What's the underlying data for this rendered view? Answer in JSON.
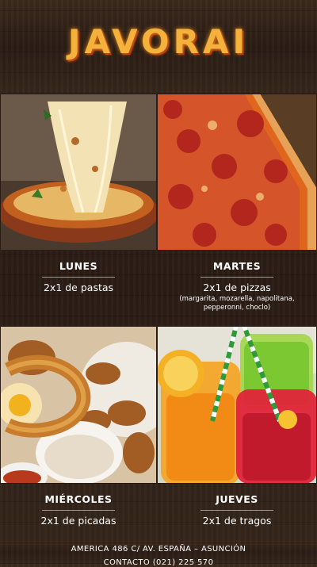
{
  "header": {
    "logo_text": "JAVORAI"
  },
  "days": [
    {
      "day": "LUNES",
      "offer": "2x1 de pastas",
      "note": "",
      "photo_icon": "pasta-icon"
    },
    {
      "day": "MARTES",
      "offer": "2x1 de pizzas",
      "note": "(margarita, mozarella, napolitana, pepperonni, choclo)",
      "photo_icon": "pizza-icon"
    },
    {
      "day": "MIÉRCOLES",
      "offer": "2x1 de picadas",
      "note": "",
      "photo_icon": "onion-rings-icon"
    },
    {
      "day": "JUEVES",
      "offer": "2x1 de tragos",
      "note": "",
      "photo_icon": "drinks-icon"
    }
  ],
  "footer": {
    "address": "AMERICA 486 C/ AV. ESPAÑA – ASUNCIÓN",
    "contact": "CONTACTO (021) 225 570"
  },
  "colors": {
    "logo": "#f4b13b",
    "wood": "#2b1d15"
  }
}
